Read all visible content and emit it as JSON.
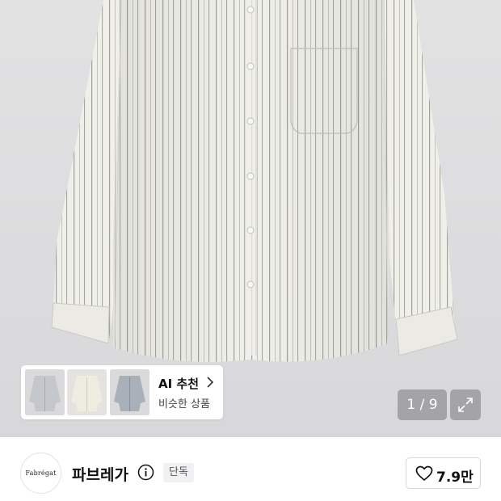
{
  "gallery": {
    "page_indicator": "1 / 9",
    "ai_recommend": {
      "title": "AI 추천",
      "subtitle": "비슷한 상품"
    }
  },
  "brand": {
    "logo_text": "Fabrégat",
    "name": "파브레가",
    "badge": "단독",
    "likes": "7.9만"
  }
}
